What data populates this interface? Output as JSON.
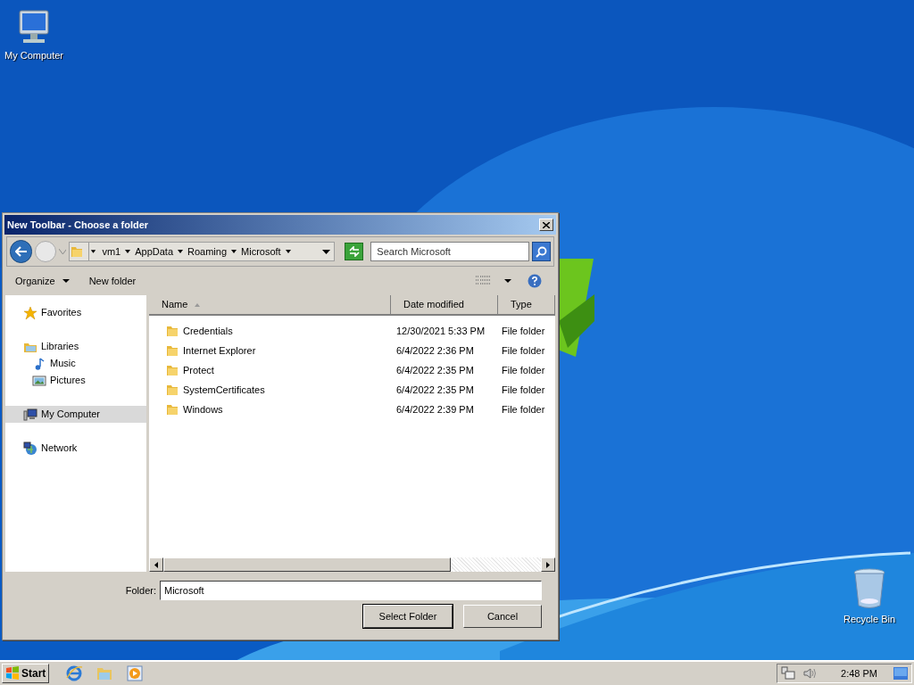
{
  "desktop_icons": [
    {
      "kind": "computer",
      "label": "My Computer"
    },
    {
      "kind": "recycle",
      "label": "Recycle Bin"
    }
  ],
  "dialog": {
    "title": "New Toolbar - Choose a folder",
    "breadcrumbs": [
      "vm1",
      "AppData",
      "Roaming",
      "Microsoft"
    ],
    "search": {
      "placeholder": "Search Microsoft"
    },
    "toolbar": {
      "organize": "Organize",
      "new_folder": "New folder"
    },
    "nav": [
      {
        "kind": "favorites",
        "label": "Favorites",
        "selected": false
      },
      {
        "kind": "libraries",
        "label": "Libraries",
        "selected": false,
        "children": [
          {
            "kind": "music",
            "label": "Music",
            "selected": false
          },
          {
            "kind": "pictures",
            "label": "Pictures",
            "selected": false
          }
        ]
      },
      {
        "kind": "computer",
        "label": "My Computer",
        "selected": true
      },
      {
        "kind": "network",
        "label": "Network",
        "selected": false
      }
    ],
    "columns": [
      {
        "label": "Name",
        "sorted": true
      },
      {
        "label": "Date modified",
        "sorted": false
      },
      {
        "label": "Type",
        "sorted": false
      }
    ],
    "rows": [
      {
        "name": "Credentials",
        "date": "12/30/2021 5:33 PM",
        "type": "File folder"
      },
      {
        "name": "Internet Explorer",
        "date": "6/4/2022 2:36 PM",
        "type": "File folder"
      },
      {
        "name": "Protect",
        "date": "6/4/2022 2:35 PM",
        "type": "File folder"
      },
      {
        "name": "SystemCertificates",
        "date": "6/4/2022 2:35 PM",
        "type": "File folder"
      },
      {
        "name": "Windows",
        "date": "6/4/2022 2:39 PM",
        "type": "File folder"
      }
    ],
    "folder_label": "Folder:",
    "folder_value": "Microsoft",
    "buttons": [
      {
        "label": "Select Folder",
        "default": true
      },
      {
        "label": "Cancel",
        "default": false
      }
    ]
  },
  "taskbar": {
    "start": "Start",
    "quick_launch": [
      {
        "kind": "browser"
      },
      {
        "kind": "explorer"
      },
      {
        "kind": "media"
      }
    ],
    "tray": [
      {
        "kind": "network"
      },
      {
        "kind": "volume"
      }
    ],
    "time": "2:48 PM"
  }
}
